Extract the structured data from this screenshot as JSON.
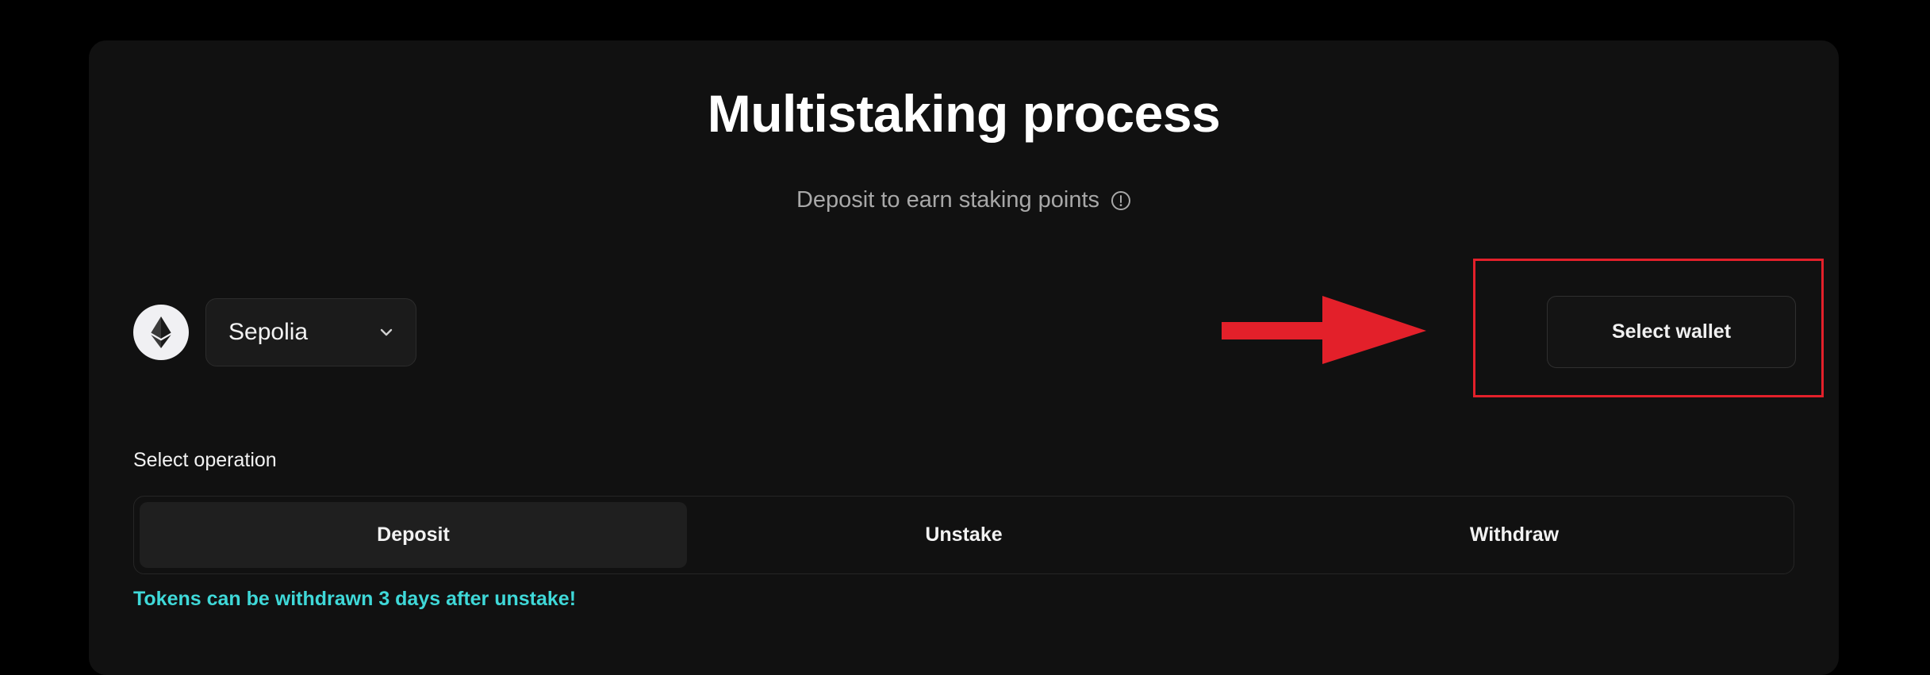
{
  "page": {
    "title": "Multistaking process",
    "subtitle": "Deposit to earn staking points"
  },
  "network": {
    "selected": "Sepolia",
    "icon": "ethereum-icon"
  },
  "wallet": {
    "button_label": "Select wallet"
  },
  "operation": {
    "label": "Select operation",
    "tabs": [
      {
        "label": "Deposit",
        "active": true
      },
      {
        "label": "Unstake",
        "active": false
      },
      {
        "label": "Withdraw",
        "active": false
      }
    ],
    "note": "Tokens can be withdrawn 3 days after unstake!"
  },
  "annotation": {
    "color": "#e3202a"
  },
  "colors": {
    "accent_note": "#3fd8d8",
    "card_bg": "#111111",
    "page_bg": "#000000"
  }
}
